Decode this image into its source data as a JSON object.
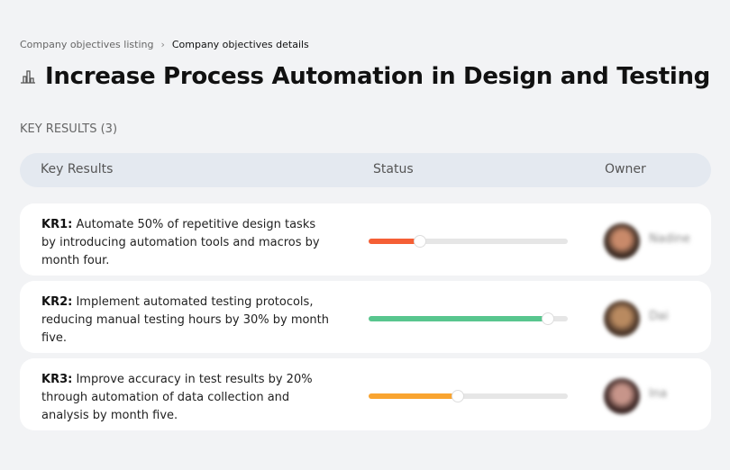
{
  "breadcrumb": {
    "parent": "Company objectives listing",
    "separator": "›",
    "current": "Company objectives details"
  },
  "title": "Increase Process Automation in Design and Testing",
  "title_icon": "building-chart-icon",
  "section_label": "KEY RESULTS (3)",
  "table": {
    "headers": [
      "Key Results",
      "Status",
      "Owner"
    ],
    "rows": [
      {
        "code": "KR1:",
        "text": " Automate 50% of repetitive design tasks by introducing automation tools and macros by month four.",
        "progress_percent": 26,
        "color": "#f55f35",
        "owner": "Nadine"
      },
      {
        "code": "KR2:",
        "text": " Implement automated testing protocols, reducing manual testing hours by 30% by month five.",
        "progress_percent": 90,
        "color": "#58c68e",
        "owner": "Dai"
      },
      {
        "code": "KR3:",
        "text": " Improve accuracy in test results by 20% through automation of data collection and analysis by month five.",
        "progress_percent": 45,
        "color": "#f9a430",
        "owner": "Ina"
      }
    ]
  }
}
